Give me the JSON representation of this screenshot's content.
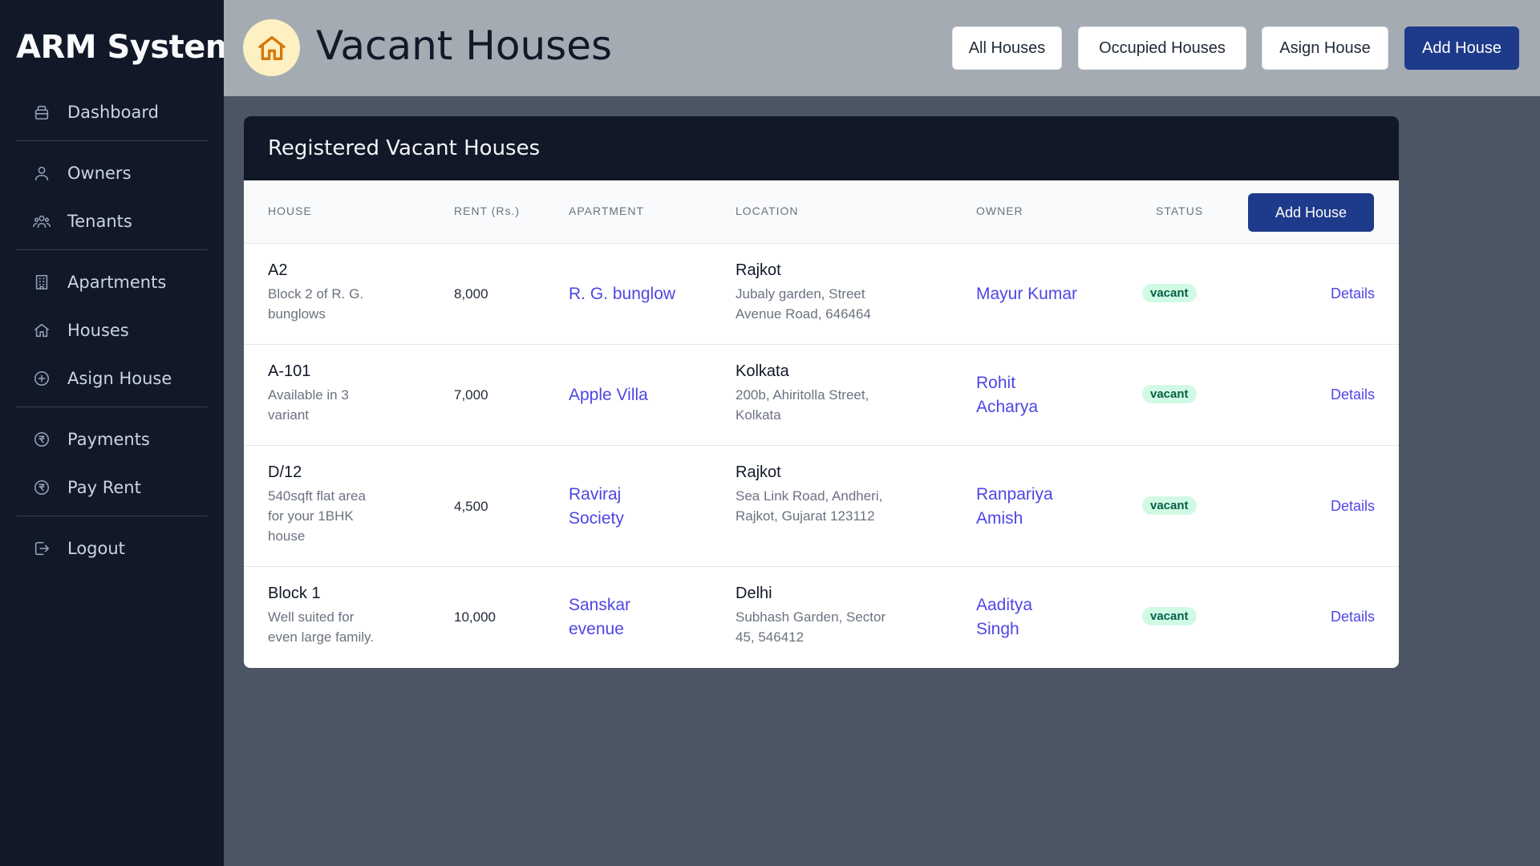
{
  "sidebar": {
    "brand": "ARM System",
    "items": [
      {
        "label": "Dashboard",
        "icon": "inbox-icon"
      },
      {
        "label": "Owners",
        "icon": "users-icon"
      },
      {
        "label": "Tenants",
        "icon": "user-group-icon"
      },
      {
        "label": "Apartments",
        "icon": "building-icon"
      },
      {
        "label": "Houses",
        "icon": "home-icon"
      },
      {
        "label": "Asign House",
        "icon": "plus-circle-icon"
      },
      {
        "label": "Payments",
        "icon": "rupee-icon"
      },
      {
        "label": "Pay Rent",
        "icon": "rupee-icon"
      },
      {
        "label": "Logout",
        "icon": "logout-icon"
      }
    ]
  },
  "header": {
    "title": "Vacant Houses",
    "title_icon": "home-icon",
    "buttons": {
      "all": "All Houses",
      "occupied": "Occupied Houses",
      "assign": "Asign House",
      "add": "Add House"
    }
  },
  "card": {
    "title": "Registered Vacant Houses",
    "columns": {
      "house": "HOUSE",
      "rent": "RENT (Rs.)",
      "apartment": "APARTMENT",
      "location": "LOCATION",
      "owner": "OWNER",
      "status": "STATUS"
    },
    "add_button": "Add House",
    "rows": [
      {
        "house": "A2",
        "desc_lines": [
          "Block 2 of R. G.",
          "bunglows"
        ],
        "rent": "8,000",
        "apartment_lines": [
          "R. G. bunglow"
        ],
        "city": "Rajkot",
        "address_lines": [
          "Jubaly garden, Street",
          "Avenue Road, 646464"
        ],
        "owner_lines": [
          "Mayur Kumar"
        ],
        "status": "vacant",
        "action": "Details"
      },
      {
        "house": "A-101",
        "desc_lines": [
          "Available in 3",
          "variant"
        ],
        "rent": "7,000",
        "apartment_lines": [
          "Apple Villa"
        ],
        "city": "Kolkata",
        "address_lines": [
          "200b, Ahiritolla Street,",
          "Kolkata"
        ],
        "owner_lines": [
          "Rohit",
          "Acharya"
        ],
        "status": "vacant",
        "action": "Details"
      },
      {
        "house": "D/12",
        "desc_lines": [
          "540sqft flat area",
          "for your 1BHK",
          "house"
        ],
        "rent": "4,500",
        "apartment_lines": [
          "Raviraj",
          "Society"
        ],
        "city": "Rajkot",
        "address_lines": [
          "Sea Link Road, Andheri,",
          "Rajkot, Gujarat 123112"
        ],
        "owner_lines": [
          "Ranpariya",
          "Amish"
        ],
        "status": "vacant",
        "action": "Details"
      },
      {
        "house": "Block 1",
        "desc_lines": [
          "Well suited for",
          "even large family."
        ],
        "rent": "10,000",
        "apartment_lines": [
          "Sanskar",
          "evenue"
        ],
        "city": "Delhi",
        "address_lines": [
          "Subhash Garden, Sector",
          "45, 546412"
        ],
        "owner_lines": [
          "Aaditya",
          "Singh"
        ],
        "status": "vacant",
        "action": "Details"
      }
    ]
  }
}
